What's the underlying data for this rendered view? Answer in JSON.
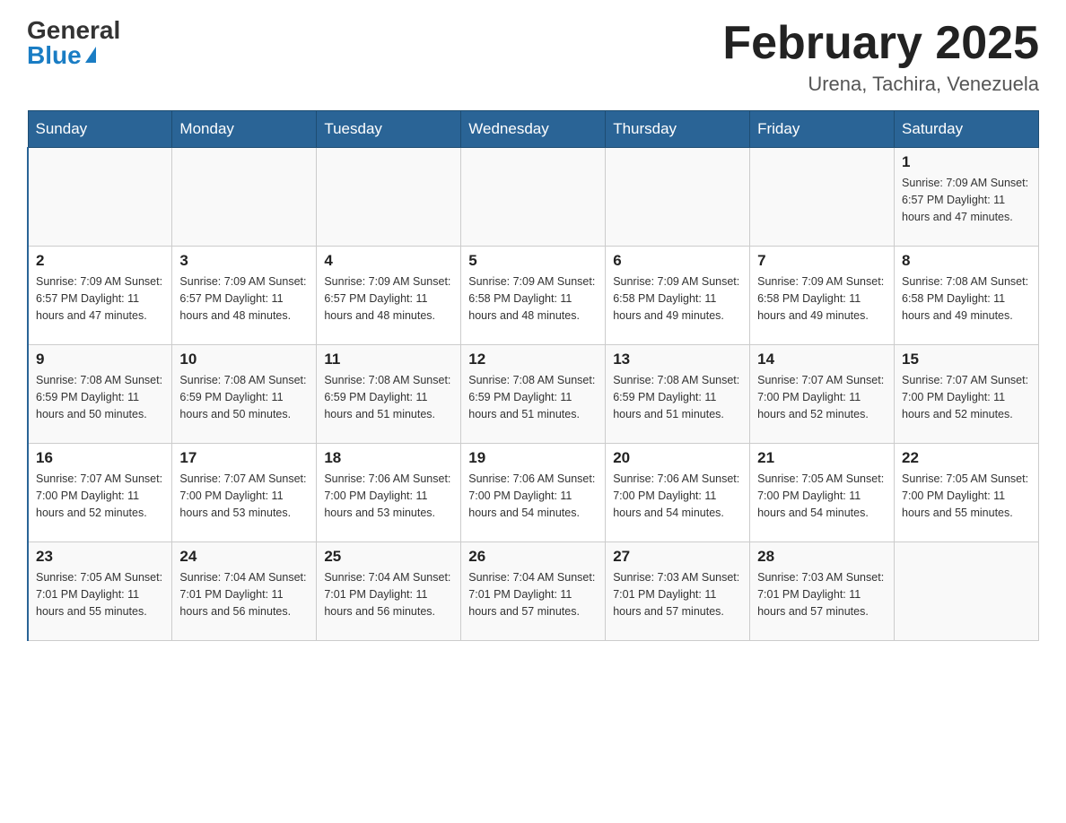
{
  "header": {
    "logo_general": "General",
    "logo_blue": "Blue",
    "month_title": "February 2025",
    "location": "Urena, Tachira, Venezuela"
  },
  "weekdays": [
    "Sunday",
    "Monday",
    "Tuesday",
    "Wednesday",
    "Thursday",
    "Friday",
    "Saturday"
  ],
  "weeks": [
    [
      {
        "day": "",
        "info": ""
      },
      {
        "day": "",
        "info": ""
      },
      {
        "day": "",
        "info": ""
      },
      {
        "day": "",
        "info": ""
      },
      {
        "day": "",
        "info": ""
      },
      {
        "day": "",
        "info": ""
      },
      {
        "day": "1",
        "info": "Sunrise: 7:09 AM\nSunset: 6:57 PM\nDaylight: 11 hours\nand 47 minutes."
      }
    ],
    [
      {
        "day": "2",
        "info": "Sunrise: 7:09 AM\nSunset: 6:57 PM\nDaylight: 11 hours\nand 47 minutes."
      },
      {
        "day": "3",
        "info": "Sunrise: 7:09 AM\nSunset: 6:57 PM\nDaylight: 11 hours\nand 48 minutes."
      },
      {
        "day": "4",
        "info": "Sunrise: 7:09 AM\nSunset: 6:57 PM\nDaylight: 11 hours\nand 48 minutes."
      },
      {
        "day": "5",
        "info": "Sunrise: 7:09 AM\nSunset: 6:58 PM\nDaylight: 11 hours\nand 48 minutes."
      },
      {
        "day": "6",
        "info": "Sunrise: 7:09 AM\nSunset: 6:58 PM\nDaylight: 11 hours\nand 49 minutes."
      },
      {
        "day": "7",
        "info": "Sunrise: 7:09 AM\nSunset: 6:58 PM\nDaylight: 11 hours\nand 49 minutes."
      },
      {
        "day": "8",
        "info": "Sunrise: 7:08 AM\nSunset: 6:58 PM\nDaylight: 11 hours\nand 49 minutes."
      }
    ],
    [
      {
        "day": "9",
        "info": "Sunrise: 7:08 AM\nSunset: 6:59 PM\nDaylight: 11 hours\nand 50 minutes."
      },
      {
        "day": "10",
        "info": "Sunrise: 7:08 AM\nSunset: 6:59 PM\nDaylight: 11 hours\nand 50 minutes."
      },
      {
        "day": "11",
        "info": "Sunrise: 7:08 AM\nSunset: 6:59 PM\nDaylight: 11 hours\nand 51 minutes."
      },
      {
        "day": "12",
        "info": "Sunrise: 7:08 AM\nSunset: 6:59 PM\nDaylight: 11 hours\nand 51 minutes."
      },
      {
        "day": "13",
        "info": "Sunrise: 7:08 AM\nSunset: 6:59 PM\nDaylight: 11 hours\nand 51 minutes."
      },
      {
        "day": "14",
        "info": "Sunrise: 7:07 AM\nSunset: 7:00 PM\nDaylight: 11 hours\nand 52 minutes."
      },
      {
        "day": "15",
        "info": "Sunrise: 7:07 AM\nSunset: 7:00 PM\nDaylight: 11 hours\nand 52 minutes."
      }
    ],
    [
      {
        "day": "16",
        "info": "Sunrise: 7:07 AM\nSunset: 7:00 PM\nDaylight: 11 hours\nand 52 minutes."
      },
      {
        "day": "17",
        "info": "Sunrise: 7:07 AM\nSunset: 7:00 PM\nDaylight: 11 hours\nand 53 minutes."
      },
      {
        "day": "18",
        "info": "Sunrise: 7:06 AM\nSunset: 7:00 PM\nDaylight: 11 hours\nand 53 minutes."
      },
      {
        "day": "19",
        "info": "Sunrise: 7:06 AM\nSunset: 7:00 PM\nDaylight: 11 hours\nand 54 minutes."
      },
      {
        "day": "20",
        "info": "Sunrise: 7:06 AM\nSunset: 7:00 PM\nDaylight: 11 hours\nand 54 minutes."
      },
      {
        "day": "21",
        "info": "Sunrise: 7:05 AM\nSunset: 7:00 PM\nDaylight: 11 hours\nand 54 minutes."
      },
      {
        "day": "22",
        "info": "Sunrise: 7:05 AM\nSunset: 7:00 PM\nDaylight: 11 hours\nand 55 minutes."
      }
    ],
    [
      {
        "day": "23",
        "info": "Sunrise: 7:05 AM\nSunset: 7:01 PM\nDaylight: 11 hours\nand 55 minutes."
      },
      {
        "day": "24",
        "info": "Sunrise: 7:04 AM\nSunset: 7:01 PM\nDaylight: 11 hours\nand 56 minutes."
      },
      {
        "day": "25",
        "info": "Sunrise: 7:04 AM\nSunset: 7:01 PM\nDaylight: 11 hours\nand 56 minutes."
      },
      {
        "day": "26",
        "info": "Sunrise: 7:04 AM\nSunset: 7:01 PM\nDaylight: 11 hours\nand 57 minutes."
      },
      {
        "day": "27",
        "info": "Sunrise: 7:03 AM\nSunset: 7:01 PM\nDaylight: 11 hours\nand 57 minutes."
      },
      {
        "day": "28",
        "info": "Sunrise: 7:03 AM\nSunset: 7:01 PM\nDaylight: 11 hours\nand 57 minutes."
      },
      {
        "day": "",
        "info": ""
      }
    ]
  ]
}
